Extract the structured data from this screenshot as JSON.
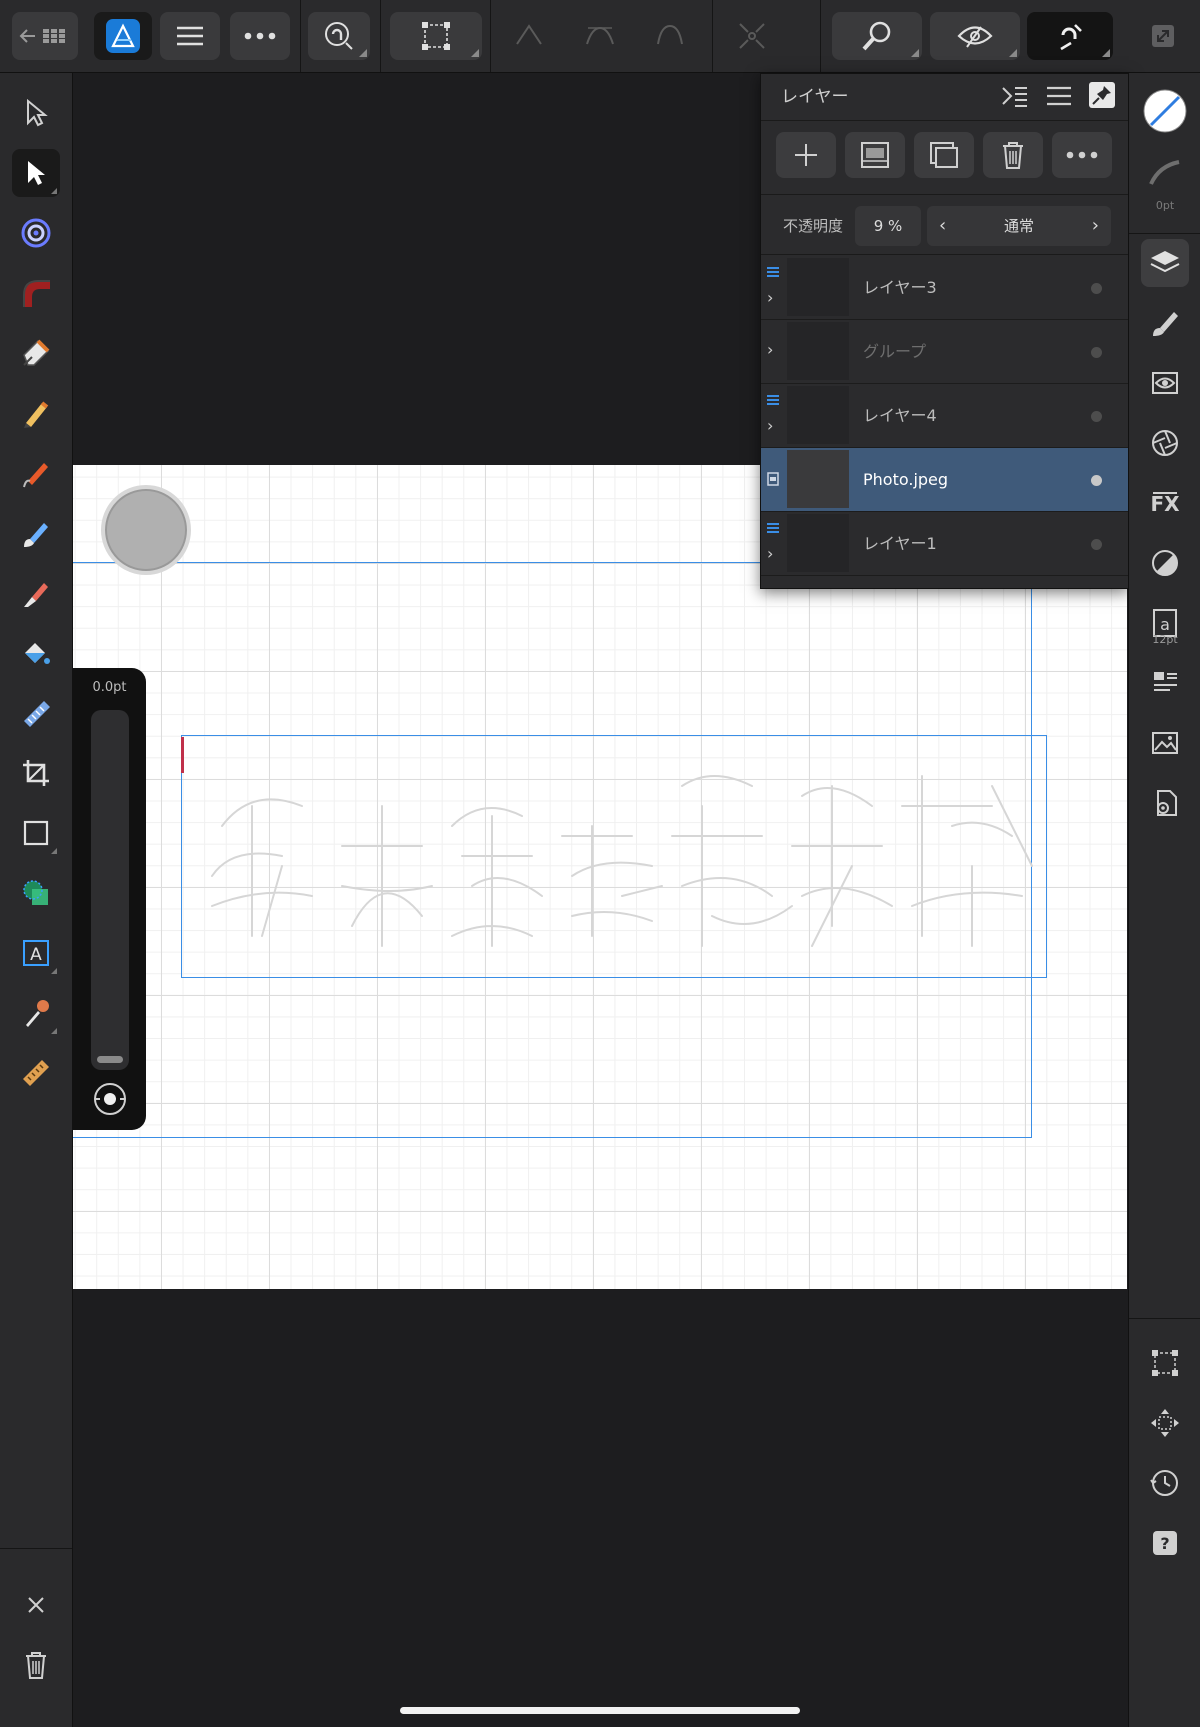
{
  "app": {
    "name": "Affinity Designer"
  },
  "toolbar": {
    "back_label": "←",
    "menu_label": "≡",
    "more_label": "•••"
  },
  "layers_panel": {
    "title": "レイヤー",
    "opacity_label": "不透明度",
    "opacity_value": "9 %",
    "blend_mode": "通常",
    "layers": [
      {
        "name": "レイヤー3",
        "selected": false,
        "expandable": true,
        "dimmed": false
      },
      {
        "name": "グループ",
        "selected": false,
        "expandable": true,
        "dimmed": true
      },
      {
        "name": "レイヤー4",
        "selected": false,
        "expandable": true,
        "dimmed": false
      },
      {
        "name": "Photo.jpeg",
        "selected": true,
        "expandable": false,
        "dimmed": false
      },
      {
        "name": "レイヤー1",
        "selected": false,
        "expandable": true,
        "dimmed": false
      }
    ]
  },
  "stroke_slider": {
    "value": "0.0pt"
  },
  "right_studio": {
    "stroke_width_label": "0pt",
    "font_size_label": "12pt"
  },
  "colors": {
    "accent": "#3a8ee6",
    "selected_row": "#3f5a7a",
    "panel": "#2b2b2d",
    "toolbar": "#2a2a2c"
  }
}
